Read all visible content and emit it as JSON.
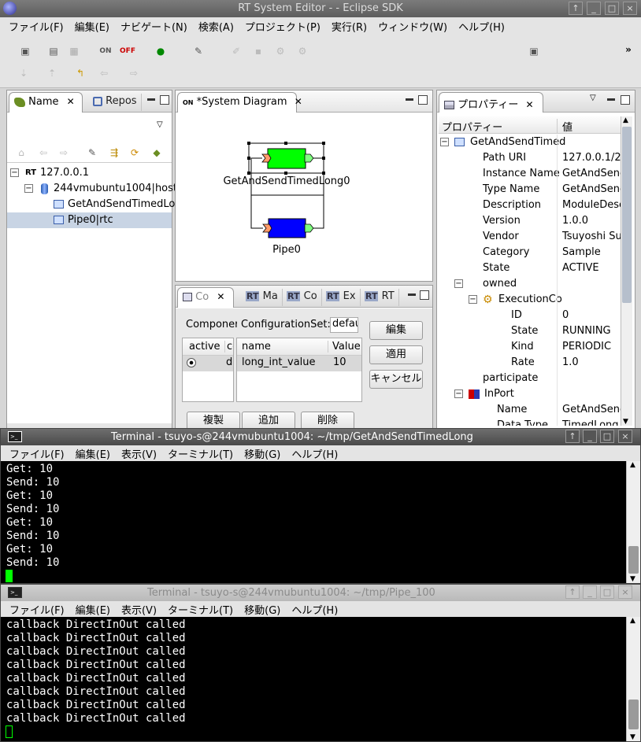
{
  "window": {
    "title": "RT System Editor -  - Eclipse SDK",
    "buttons": [
      "↑",
      "_",
      "□",
      "×"
    ]
  },
  "menubar": [
    "ファイル(F)",
    "編集(E)",
    "ナビゲート(N)",
    "検索(A)",
    "プロジェクト(P)",
    "実行(R)",
    "ウィンドウ(W)",
    "ヘルプ(H)"
  ],
  "toolbar": {
    "overflow": "»"
  },
  "name_view": {
    "tab_label": "Name",
    "tab2_label": "Repos",
    "tree": [
      {
        "label": "127.0.0.1",
        "prefix": "RT"
      },
      {
        "label": "244vmubuntu1004|host_"
      },
      {
        "label": "GetAndSendTimedLo"
      },
      {
        "label": "Pipe0|rtc"
      }
    ]
  },
  "diagram": {
    "tab_label": "*System Diagram",
    "components": [
      {
        "label": "GetAndSendTimedLong0",
        "color": "#00ff00"
      },
      {
        "label": "Pipe0",
        "color": "#0000ff"
      }
    ]
  },
  "config_view": {
    "tabs": [
      "Co",
      "Ma",
      "Co",
      "Ex",
      "RT"
    ],
    "tab_prefix": "RT",
    "component_label": "Componer",
    "configset_label": "ConfigurationSet:",
    "configset_value": "defau",
    "left_table": {
      "headers": [
        "active",
        "co"
      ],
      "row": [
        "",
        "d"
      ]
    },
    "right_table": {
      "headers": [
        "name",
        "Value"
      ],
      "row": [
        "long_int_value",
        "10"
      ]
    },
    "side_buttons": [
      "編集",
      "適用",
      "キャンセル"
    ],
    "bottom_buttons": [
      "複製",
      "追加",
      "削除"
    ]
  },
  "properties": {
    "tab_label": "プロパティー",
    "headers": [
      "プロパティー",
      "値"
    ],
    "rows": [
      {
        "key": "GetAndSendTimed",
        "value": "",
        "level": 0,
        "expander": "−",
        "icon": "component"
      },
      {
        "key": "Path URI",
        "value": "127.0.0.1/24",
        "level": 1
      },
      {
        "key": "Instance Name",
        "value": "GetAndSend",
        "level": 1
      },
      {
        "key": "Type Name",
        "value": "GetAndSend",
        "level": 1
      },
      {
        "key": "Description",
        "value": "ModuleDesc",
        "level": 1
      },
      {
        "key": "Version",
        "value": "1.0.0",
        "level": 1
      },
      {
        "key": "Vendor",
        "value": "Tsuyoshi Su",
        "level": 1
      },
      {
        "key": "Category",
        "value": "Sample",
        "level": 1
      },
      {
        "key": "State",
        "value": "ACTIVE",
        "level": 1
      },
      {
        "key": "owned",
        "value": "",
        "level": 1,
        "expander": "−"
      },
      {
        "key": "ExecutionCo",
        "value": "",
        "level": 2,
        "expander": "−",
        "icon": "gears"
      },
      {
        "key": "ID",
        "value": "0",
        "level": 3
      },
      {
        "key": "State",
        "value": "RUNNING",
        "level": 3
      },
      {
        "key": "Kind",
        "value": "PERIODIC",
        "level": 3
      },
      {
        "key": "Rate",
        "value": "1.0",
        "level": 3
      },
      {
        "key": "participate",
        "value": "",
        "level": 1
      },
      {
        "key": "InPort",
        "value": "",
        "level": 1,
        "expander": "−",
        "icon": "inport"
      },
      {
        "key": "Name",
        "value": "GetAndSend",
        "level": 2
      },
      {
        "key": "Data Type",
        "value": "TimedLong",
        "level": 2
      }
    ]
  },
  "terminal1": {
    "title": "Terminal - tsuyo-s@244vmubuntu1004: ~/tmp/GetAndSendTimedLong",
    "menu": [
      "ファイル(F)",
      "編集(E)",
      "表示(V)",
      "ターミナル(T)",
      "移動(G)",
      "ヘルプ(H)"
    ],
    "lines": [
      "Get: 10",
      "Send: 10",
      "Get: 10",
      "Send: 10",
      "Get: 10",
      "Send: 10",
      "Get: 10",
      "Send: 10"
    ],
    "cursor_color": "#00ff00"
  },
  "terminal2": {
    "title": "Terminal - tsuyo-s@244vmubuntu1004: ~/tmp/Pipe_100",
    "menu": [
      "ファイル(F)",
      "編集(E)",
      "表示(V)",
      "ターミナル(T)",
      "移動(G)",
      "ヘルプ(H)"
    ],
    "lines": [
      "callback DirectInOut called",
      "callback DirectInOut called",
      "callback DirectInOut called",
      "callback DirectInOut called",
      "callback DirectInOut called",
      "callback DirectInOut called",
      "callback DirectInOut called",
      "callback DirectInOut called"
    ]
  }
}
